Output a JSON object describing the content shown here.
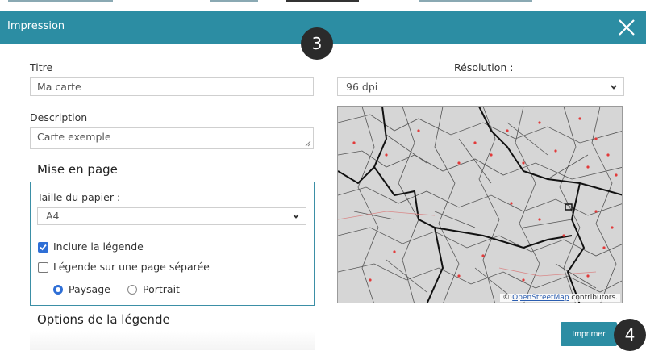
{
  "dialog": {
    "title": "Impression",
    "close_icon": "close-icon"
  },
  "badges": {
    "step3": "3",
    "step4": "4"
  },
  "form": {
    "titre_label": "Titre",
    "titre_value": "Ma carte",
    "description_label": "Description",
    "description_value": "Carte exemple",
    "resolution_label": "Résolution :",
    "resolution_value": "96 dpi"
  },
  "layout_section": {
    "title": "Mise en page",
    "paper_label": "Taille du papier :",
    "paper_value": "A4",
    "include_legend_label": "Inclure la légende",
    "include_legend_checked": true,
    "separate_page_label": "Légende sur une page séparée",
    "separate_page_checked": false,
    "orientation_landscape": "Paysage",
    "orientation_portrait": "Portrait",
    "orientation_selected": "Paysage"
  },
  "legend_section": {
    "title": "Options de la légende"
  },
  "map": {
    "attribution_prefix": "© ",
    "attribution_link": "OpenStreetMap",
    "attribution_suffix": " contributors."
  },
  "actions": {
    "print_label": "Imprimer"
  },
  "colors": {
    "header": "#2c8da3",
    "accent": "#2f6fd6",
    "map_background": "#d6d6d6",
    "map_points": "#e23a3a"
  }
}
